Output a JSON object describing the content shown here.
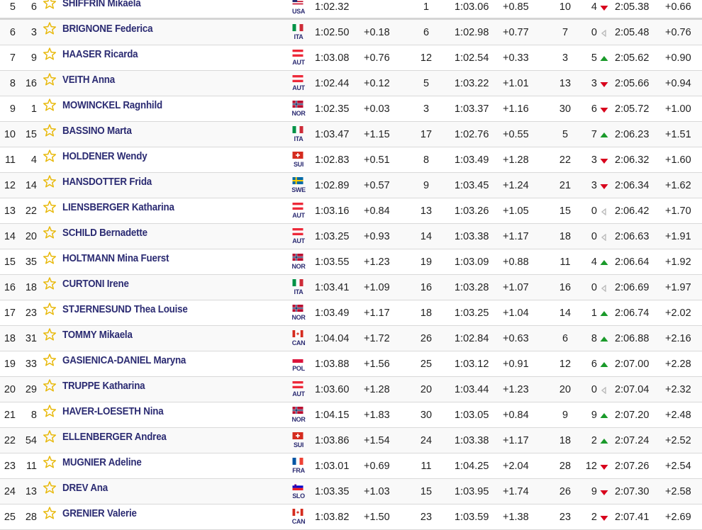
{
  "rows": [
    {
      "rank": "5",
      "bib": "6",
      "name": "SHIFFRIN Mikaela",
      "nation": "USA",
      "run1": "1:02.32",
      "diff1": "",
      "rank2": "1",
      "run2": "1:03.06",
      "diff2": "+0.85",
      "points": "10",
      "change": "4",
      "trend": "down",
      "total": "2:05.38",
      "diff": "+0.66"
    },
    {
      "rank": "6",
      "bib": "3",
      "name": "BRIGNONE Federica",
      "nation": "ITA",
      "run1": "1:02.50",
      "diff1": "+0.18",
      "rank2": "6",
      "run2": "1:02.98",
      "diff2": "+0.77",
      "points": "7",
      "change": "0",
      "trend": "same",
      "total": "2:05.48",
      "diff": "+0.76"
    },
    {
      "rank": "7",
      "bib": "9",
      "name": "HAASER Ricarda",
      "nation": "AUT",
      "run1": "1:03.08",
      "diff1": "+0.76",
      "rank2": "12",
      "run2": "1:02.54",
      "diff2": "+0.33",
      "points": "3",
      "change": "5",
      "trend": "up",
      "total": "2:05.62",
      "diff": "+0.90"
    },
    {
      "rank": "8",
      "bib": "16",
      "name": "VEITH Anna",
      "nation": "AUT",
      "run1": "1:02.44",
      "diff1": "+0.12",
      "rank2": "5",
      "run2": "1:03.22",
      "diff2": "+1.01",
      "points": "13",
      "change": "3",
      "trend": "down",
      "total": "2:05.66",
      "diff": "+0.94"
    },
    {
      "rank": "9",
      "bib": "1",
      "name": "MOWINCKEL Ragnhild",
      "nation": "NOR",
      "run1": "1:02.35",
      "diff1": "+0.03",
      "rank2": "3",
      "run2": "1:03.37",
      "diff2": "+1.16",
      "points": "30",
      "change": "6",
      "trend": "down",
      "total": "2:05.72",
      "diff": "+1.00"
    },
    {
      "rank": "10",
      "bib": "15",
      "name": "BASSINO Marta",
      "nation": "ITA",
      "run1": "1:03.47",
      "diff1": "+1.15",
      "rank2": "17",
      "run2": "1:02.76",
      "diff2": "+0.55",
      "points": "5",
      "change": "7",
      "trend": "up",
      "total": "2:06.23",
      "diff": "+1.51"
    },
    {
      "rank": "11",
      "bib": "4",
      "name": "HOLDENER Wendy",
      "nation": "SUI",
      "run1": "1:02.83",
      "diff1": "+0.51",
      "rank2": "8",
      "run2": "1:03.49",
      "diff2": "+1.28",
      "points": "22",
      "change": "3",
      "trend": "down",
      "total": "2:06.32",
      "diff": "+1.60"
    },
    {
      "rank": "12",
      "bib": "14",
      "name": "HANSDOTTER Frida",
      "nation": "SWE",
      "run1": "1:02.89",
      "diff1": "+0.57",
      "rank2": "9",
      "run2": "1:03.45",
      "diff2": "+1.24",
      "points": "21",
      "change": "3",
      "trend": "down",
      "total": "2:06.34",
      "diff": "+1.62"
    },
    {
      "rank": "13",
      "bib": "22",
      "name": "LIENSBERGER Katharina",
      "nation": "AUT",
      "run1": "1:03.16",
      "diff1": "+0.84",
      "rank2": "13",
      "run2": "1:03.26",
      "diff2": "+1.05",
      "points": "15",
      "change": "0",
      "trend": "same",
      "total": "2:06.42",
      "diff": "+1.70"
    },
    {
      "rank": "14",
      "bib": "20",
      "name": "SCHILD Bernadette",
      "nation": "AUT",
      "run1": "1:03.25",
      "diff1": "+0.93",
      "rank2": "14",
      "run2": "1:03.38",
      "diff2": "+1.17",
      "points": "18",
      "change": "0",
      "trend": "same",
      "total": "2:06.63",
      "diff": "+1.91"
    },
    {
      "rank": "15",
      "bib": "35",
      "name": "HOLTMANN Mina Fuerst",
      "nation": "NOR",
      "run1": "1:03.55",
      "diff1": "+1.23",
      "rank2": "19",
      "run2": "1:03.09",
      "diff2": "+0.88",
      "points": "11",
      "change": "4",
      "trend": "up",
      "total": "2:06.64",
      "diff": "+1.92"
    },
    {
      "rank": "16",
      "bib": "18",
      "name": "CURTONI Irene",
      "nation": "ITA",
      "run1": "1:03.41",
      "diff1": "+1.09",
      "rank2": "16",
      "run2": "1:03.28",
      "diff2": "+1.07",
      "points": "16",
      "change": "0",
      "trend": "same",
      "total": "2:06.69",
      "diff": "+1.97"
    },
    {
      "rank": "17",
      "bib": "23",
      "name": "STJERNESUND Thea Louise",
      "nation": "NOR",
      "run1": "1:03.49",
      "diff1": "+1.17",
      "rank2": "18",
      "run2": "1:03.25",
      "diff2": "+1.04",
      "points": "14",
      "change": "1",
      "trend": "up",
      "total": "2:06.74",
      "diff": "+2.02"
    },
    {
      "rank": "18",
      "bib": "31",
      "name": "TOMMY Mikaela",
      "nation": "CAN",
      "run1": "1:04.04",
      "diff1": "+1.72",
      "rank2": "26",
      "run2": "1:02.84",
      "diff2": "+0.63",
      "points": "6",
      "change": "8",
      "trend": "up",
      "total": "2:06.88",
      "diff": "+2.16"
    },
    {
      "rank": "19",
      "bib": "33",
      "name": "GASIENICA-DANIEL Maryna",
      "nation": "POL",
      "run1": "1:03.88",
      "diff1": "+1.56",
      "rank2": "25",
      "run2": "1:03.12",
      "diff2": "+0.91",
      "points": "12",
      "change": "6",
      "trend": "up",
      "total": "2:07.00",
      "diff": "+2.28"
    },
    {
      "rank": "20",
      "bib": "29",
      "name": "TRUPPE Katharina",
      "nation": "AUT",
      "run1": "1:03.60",
      "diff1": "+1.28",
      "rank2": "20",
      "run2": "1:03.44",
      "diff2": "+1.23",
      "points": "20",
      "change": "0",
      "trend": "same",
      "total": "2:07.04",
      "diff": "+2.32"
    },
    {
      "rank": "21",
      "bib": "8",
      "name": "HAVER-LOESETH Nina",
      "nation": "NOR",
      "run1": "1:04.15",
      "diff1": "+1.83",
      "rank2": "30",
      "run2": "1:03.05",
      "diff2": "+0.84",
      "points": "9",
      "change": "9",
      "trend": "up",
      "total": "2:07.20",
      "diff": "+2.48"
    },
    {
      "rank": "22",
      "bib": "54",
      "name": "ELLENBERGER Andrea",
      "nation": "SUI",
      "run1": "1:03.86",
      "diff1": "+1.54",
      "rank2": "24",
      "run2": "1:03.38",
      "diff2": "+1.17",
      "points": "18",
      "change": "2",
      "trend": "up",
      "total": "2:07.24",
      "diff": "+2.52"
    },
    {
      "rank": "23",
      "bib": "11",
      "name": "MUGNIER Adeline",
      "nation": "FRA",
      "run1": "1:03.01",
      "diff1": "+0.69",
      "rank2": "11",
      "run2": "1:04.25",
      "diff2": "+2.04",
      "points": "28",
      "change": "12",
      "trend": "down",
      "total": "2:07.26",
      "diff": "+2.54"
    },
    {
      "rank": "24",
      "bib": "13",
      "name": "DREV Ana",
      "nation": "SLO",
      "run1": "1:03.35",
      "diff1": "+1.03",
      "rank2": "15",
      "run2": "1:03.95",
      "diff2": "+1.74",
      "points": "26",
      "change": "9",
      "trend": "down",
      "total": "2:07.30",
      "diff": "+2.58"
    },
    {
      "rank": "25",
      "bib": "28",
      "name": "GRENIER Valerie",
      "nation": "CAN",
      "run1": "1:03.82",
      "diff1": "+1.50",
      "rank2": "23",
      "run2": "1:03.59",
      "diff2": "+1.38",
      "points": "23",
      "change": "2",
      "trend": "down",
      "total": "2:07.41",
      "diff": "+2.69"
    }
  ],
  "colors": {
    "name": "#2b2b72",
    "star": "#e8b90c",
    "up": "#1a9a2a",
    "down": "#d8001c",
    "same": "#bbbbbb",
    "row_border": "#d9d9d9"
  },
  "icons": {
    "favorite": "star-outline-icon",
    "up": "triangle-up-icon",
    "down": "triangle-down-icon",
    "same": "triangle-left-icon"
  }
}
